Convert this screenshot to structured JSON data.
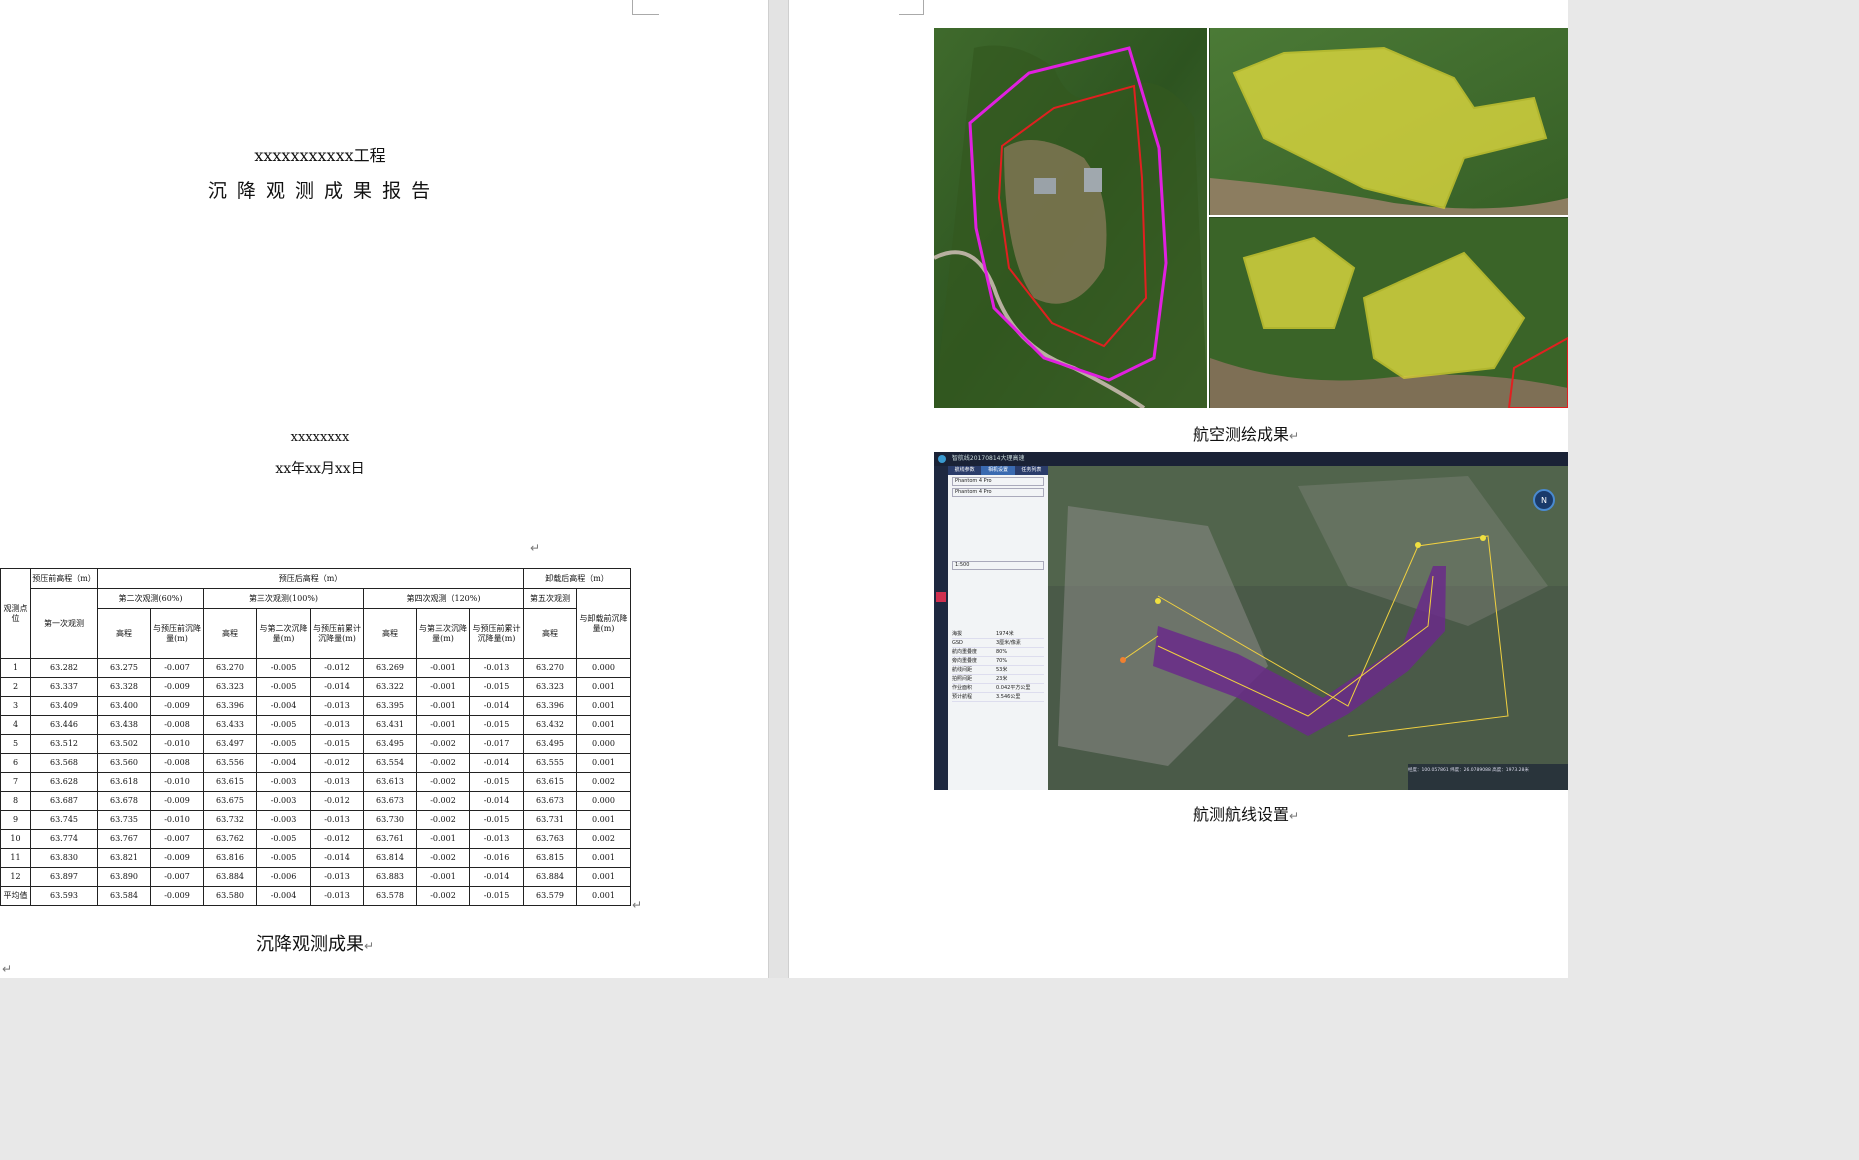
{
  "cover": {
    "project": "xxxxxxxxxxx工程",
    "title": "沉 降 观 测 成 果 报 告",
    "org": "xxxxxxxx",
    "date": "xx年xx月xx日"
  },
  "table": {
    "header1": {
      "point": "观测点位",
      "pre": "预压前高程（m）",
      "post": "预压后高程（m）",
      "unload": "卸载后高程（m）"
    },
    "header2": {
      "obs1": "第一次观测",
      "obs2": "第二次观测(60%)",
      "obs3": "第三次观测(100%)",
      "obs4": "第四次观测（120%)",
      "obs5": "第五次观测"
    },
    "header3": {
      "elev": "高程",
      "d_pre": "与预压前沉降量(m)",
      "d_2nd": "与第二次沉降量(m)",
      "d_cum": "与预压前累计沉降量(m)",
      "d_3rd": "与第三次沉降量(m)",
      "d_unload": "与卸载前沉降量(m)"
    },
    "rows": [
      [
        "1",
        "63.282",
        "63.275",
        "-0.007",
        "63.270",
        "-0.005",
        "-0.012",
        "63.269",
        "-0.001",
        "-0.013",
        "63.270",
        "0.000"
      ],
      [
        "2",
        "63.337",
        "63.328",
        "-0.009",
        "63.323",
        "-0.005",
        "-0.014",
        "63.322",
        "-0.001",
        "-0.015",
        "63.323",
        "0.001"
      ],
      [
        "3",
        "63.409",
        "63.400",
        "-0.009",
        "63.396",
        "-0.004",
        "-0.013",
        "63.395",
        "-0.001",
        "-0.014",
        "63.396",
        "0.001"
      ],
      [
        "4",
        "63.446",
        "63.438",
        "-0.008",
        "63.433",
        "-0.005",
        "-0.013",
        "63.431",
        "-0.001",
        "-0.015",
        "63.432",
        "0.001"
      ],
      [
        "5",
        "63.512",
        "63.502",
        "-0.010",
        "63.497",
        "-0.005",
        "-0.015",
        "63.495",
        "-0.002",
        "-0.017",
        "63.495",
        "0.000"
      ],
      [
        "6",
        "63.568",
        "63.560",
        "-0.008",
        "63.556",
        "-0.004",
        "-0.012",
        "63.554",
        "-0.002",
        "-0.014",
        "63.555",
        "0.001"
      ],
      [
        "7",
        "63.628",
        "63.618",
        "-0.010",
        "63.615",
        "-0.003",
        "-0.013",
        "63.613",
        "-0.002",
        "-0.015",
        "63.615",
        "0.002"
      ],
      [
        "8",
        "63.687",
        "63.678",
        "-0.009",
        "63.675",
        "-0.003",
        "-0.012",
        "63.673",
        "-0.002",
        "-0.014",
        "63.673",
        "0.000"
      ],
      [
        "9",
        "63.745",
        "63.735",
        "-0.010",
        "63.732",
        "-0.003",
        "-0.013",
        "63.730",
        "-0.002",
        "-0.015",
        "63.731",
        "0.001"
      ],
      [
        "10",
        "63.774",
        "63.767",
        "-0.007",
        "63.762",
        "-0.005",
        "-0.012",
        "63.761",
        "-0.001",
        "-0.013",
        "63.763",
        "0.002"
      ],
      [
        "11",
        "63.830",
        "63.821",
        "-0.009",
        "63.816",
        "-0.005",
        "-0.014",
        "63.814",
        "-0.002",
        "-0.016",
        "63.815",
        "0.001"
      ],
      [
        "12",
        "63.897",
        "63.890",
        "-0.007",
        "63.884",
        "-0.006",
        "-0.013",
        "63.883",
        "-0.001",
        "-0.014",
        "63.884",
        "0.001"
      ],
      [
        "平均值",
        "63.593",
        "63.584",
        "-0.009",
        "63.580",
        "-0.004",
        "-0.013",
        "63.578",
        "-0.002",
        "-0.015",
        "63.579",
        "0.001"
      ]
    ],
    "caption": "沉降观测成果"
  },
  "right": {
    "caption1": "航空测绘成果",
    "caption2": "航测航线设置",
    "ui_title": "智航线20170814大理高速",
    "ui_tabs": [
      "航线参数",
      "相机设置",
      "任务列表"
    ],
    "ui_model": "Phantom 4 Pro",
    "ui_scale": "1:500",
    "ui_rows": [
      {
        "k": "海拔",
        "v": "1974米"
      },
      {
        "k": "GSD",
        "v": "3厘米/像素"
      },
      {
        "k": "航向重叠度",
        "v": "80%"
      },
      {
        "k": "旁向重叠度",
        "v": "70%"
      },
      {
        "k": "航线间距",
        "v": "53米"
      },
      {
        "k": "拍照间距",
        "v": "23米"
      },
      {
        "k": "作业面积",
        "v": "0.042平方公里"
      },
      {
        "k": "预计航程",
        "v": "3.546公里"
      }
    ],
    "ui_status": "经度：100.057861 纬度：26.0789088 高度：1973.28米"
  },
  "colors": {
    "boundary_magenta": "#e020e0",
    "boundary_red": "#e02020",
    "area_yellow": "#e8e040",
    "route_purple": "#6a2a8a",
    "route_line": "#f0d040"
  },
  "marks": {
    "return": "↵"
  }
}
